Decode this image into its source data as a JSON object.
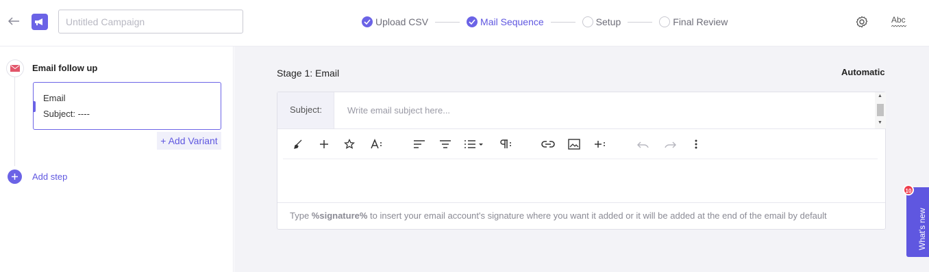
{
  "header": {
    "campaign_placeholder": "Untitled Campaign",
    "steps": [
      {
        "label": "Upload CSV",
        "state": "done"
      },
      {
        "label": "Mail Sequence",
        "state": "active"
      },
      {
        "label": "Setup",
        "state": "todo"
      },
      {
        "label": "Final Review",
        "state": "todo"
      }
    ],
    "spellcheck_label": "Abc"
  },
  "sidebar": {
    "step_title": "Email follow up",
    "variant": {
      "type": "Email",
      "subject": "Subject: ----"
    },
    "add_variant": "+ Add Variant",
    "add_step": "Add step"
  },
  "editor": {
    "stage_title": "Stage 1: Email",
    "mode": "Automatic",
    "subject_label": "Subject:",
    "subject_placeholder": "Write email subject here...",
    "footer_prefix": "Type ",
    "footer_token": "%signature%",
    "footer_suffix": " to insert your email account's signature where you want it added or it will be added at the end of the email by default"
  },
  "whats_new": {
    "label": "What's new",
    "badge": "10"
  },
  "colors": {
    "accent": "#6b63e6",
    "badge": "#ef3d4d",
    "panel_bg": "#f3f3f7"
  }
}
